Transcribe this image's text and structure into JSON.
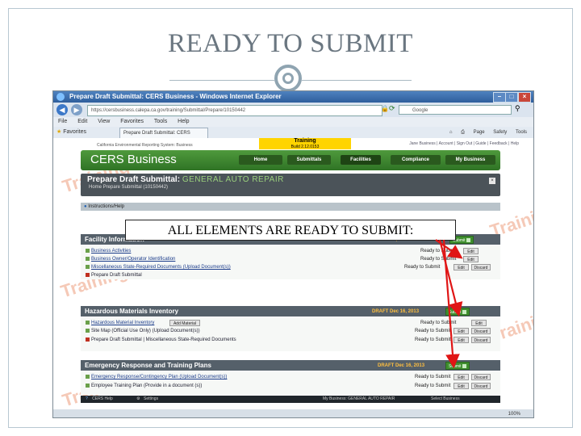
{
  "slide": {
    "title": "READY TO SUBMIT",
    "overlay_text": "ALL ELEMENTS ARE READY TO SUBMIT:"
  },
  "browser": {
    "window_title": "Prepare Draft Submittal: CERS Business - Windows Internet Explorer",
    "address": "https://cersbusiness.calepa.ca.gov/training/Submittal/Prepare/10150442",
    "search_placeholder": "Google",
    "menu": [
      "File",
      "Edit",
      "View",
      "Favorites",
      "Tools",
      "Help"
    ],
    "favorites_label": "Favorites",
    "tab_label": "Prepare Draft Submittal: CERS Business",
    "tools": [
      "Page",
      "Safety",
      "Tools"
    ],
    "status_zoom": "100%"
  },
  "cers": {
    "training_label": "Training",
    "version": "Build 2.12.0153",
    "top_left": "California Environmental Reporting System: Business",
    "top_links": "Jane Business | Account | Sign Out | Guide | Feedback | Help",
    "brand": "CERS Business",
    "nav": [
      "Home",
      "Submittals",
      "Facilities",
      "Compliance",
      "My Business"
    ],
    "panel_title": "Prepare Draft Submittal:",
    "business_name": "GENERAL AUTO REPAIR",
    "breadcrumb": "Home   Prepare Submittal (10150442)",
    "instructions_label": "Instructions/Help",
    "watermark": "Training",
    "sections": [
      {
        "title": "Facility Information",
        "draft": "DRAFT Dec 16, 2013",
        "submit": "Submit",
        "rows": [
          {
            "text": "Business Activities",
            "status": "Ready to Submit",
            "buttons": [
              "Edit"
            ]
          },
          {
            "text": "Business Owner/Operator Identification",
            "status": "Ready to Submit",
            "buttons": [
              "Edit"
            ]
          },
          {
            "text": "Miscellaneous State-Required Documents (Upload Document(s))",
            "status": "Ready to Submit",
            "buttons": [
              "Edit",
              "Discard"
            ]
          },
          {
            "text": "Prepare Draft Submittal",
            "status": "",
            "buttons": []
          }
        ]
      },
      {
        "title": "Hazardous Materials Inventory",
        "draft": "DRAFT Dec 16, 2013",
        "submit": "Submit",
        "rows": [
          {
            "text": "Hazardous Material Inventory",
            "add": "Add Material",
            "status": "Ready to Submit",
            "buttons": [
              "Edit"
            ]
          },
          {
            "text": "Site Map (Official Use Only) (Upload Document(s))",
            "status": "Ready to Submit",
            "buttons": [
              "Edit",
              "Discard"
            ]
          },
          {
            "text": "Prepare Draft Submittal | Miscellaneous State-Required Documents",
            "status": "Ready to Submit",
            "buttons": [
              "Edit",
              "Discard"
            ]
          }
        ]
      },
      {
        "title": "Emergency Response and Training Plans",
        "draft": "DRAFT Dec 16, 2013",
        "submit": "Submit",
        "rows": [
          {
            "text": "Emergency Response/Contingency Plan (Upload Document(s))",
            "status": "Ready to Submit",
            "buttons": [
              "Edit",
              "Discard"
            ]
          },
          {
            "text": "Employee Training Plan (Provide in a document (s))",
            "status": "Ready to Submit",
            "buttons": [
              "Edit",
              "Discard"
            ]
          }
        ]
      }
    ],
    "taskbar": {
      "help": "CERS Help",
      "settings": "Settings",
      "business": "My Business: GENERAL AUTO REPAIR",
      "select": "Select Business"
    }
  },
  "colors": {
    "cers_green": "#3f8f2e",
    "section_dark": "#55606a",
    "training_yellow": "#ffd400",
    "arrow_red": "#e01515"
  },
  "icons": [
    "back-icon",
    "forward-icon",
    "lock-icon",
    "refresh-icon",
    "close-icon",
    "search-icon",
    "star-icon",
    "home-icon",
    "print-icon"
  ]
}
